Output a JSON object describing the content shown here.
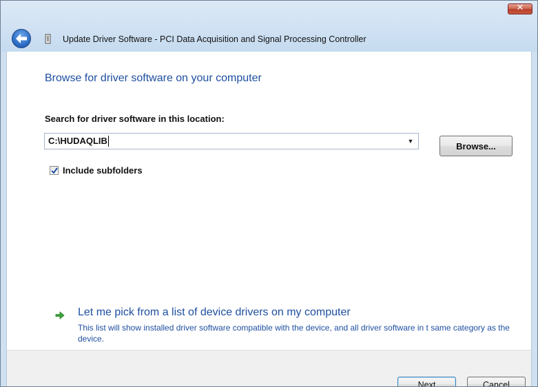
{
  "window": {
    "title": "Update Driver Software - PCI Data Acquisition and Signal Processing Controller",
    "close_glyph": "✕"
  },
  "page": {
    "heading": "Browse for driver software on your computer",
    "search_label": "Search for driver software in this location:",
    "path_value": "C:\\HUDAQLIB",
    "browse_label": "Browse...",
    "include_subfolders_label": "Include subfolders",
    "include_subfolders_checked": true,
    "pick_link": "Let me pick from a list of device drivers on my computer",
    "pick_description": "This list will show installed driver software compatible with the device, and all driver software in t same category as the device."
  },
  "footer": {
    "next_label": "Next",
    "cancel_label": "Cancel"
  },
  "icons": {
    "back": "back-arrow-icon",
    "device": "device-icon",
    "dropdown": "chevron-down-icon",
    "pick": "green-arrow-icon"
  },
  "colors": {
    "link_blue": "#1e4fa0",
    "frame": "#cfe0f1"
  }
}
